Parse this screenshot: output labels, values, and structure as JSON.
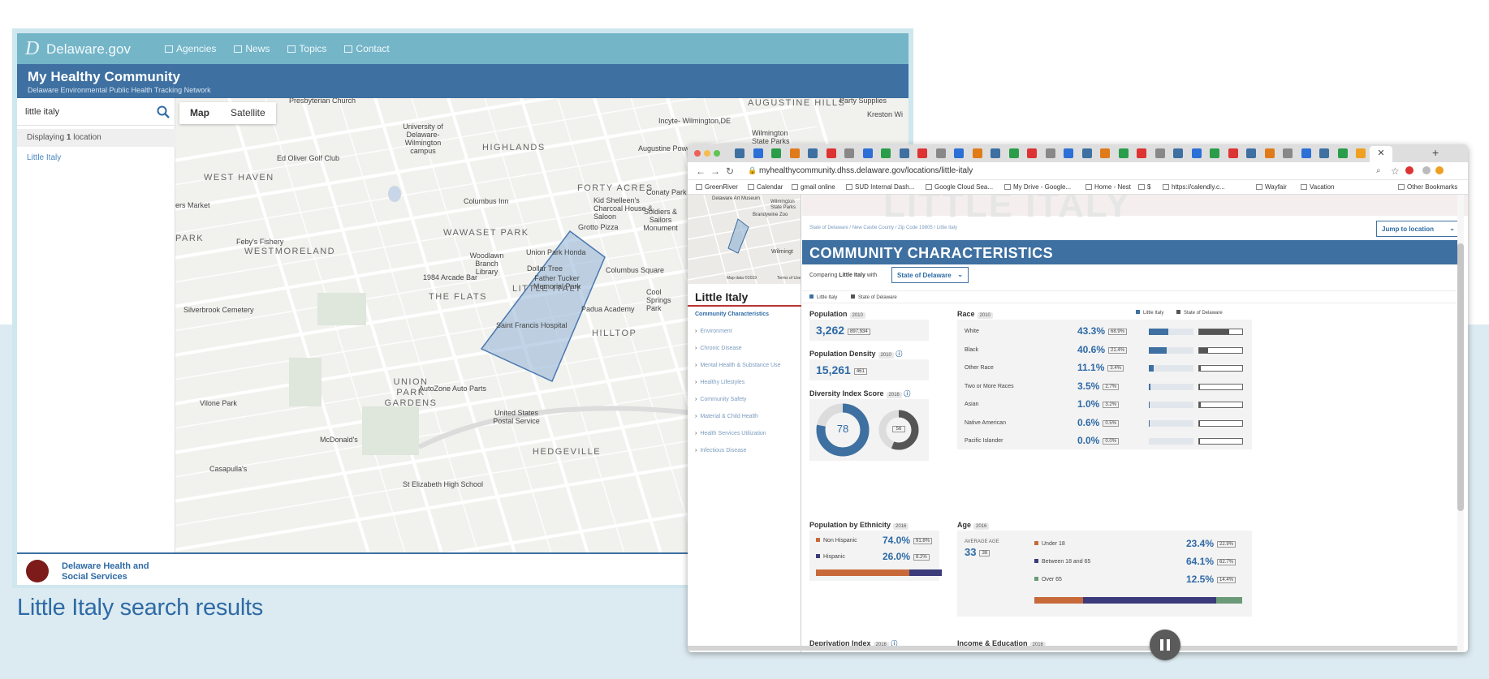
{
  "caption": "Little Italy search results",
  "left_shot": {
    "gov_name": "Delaware.gov",
    "gov_nav": [
      "Agencies",
      "News",
      "Topics",
      "Contact"
    ],
    "app_title": "My Healthy Community",
    "app_subtitle": "Delaware Environmental Public Health Tracking Network",
    "search_value": "little italy",
    "display_prefix": "Displaying ",
    "display_count": "1",
    "display_suffix": " location",
    "result": "Little Italy",
    "map_tabs": [
      "Map",
      "Satellite"
    ],
    "map_areas": [
      "WEST HAVEN",
      "WESTMORELAND",
      "WAWASET PARK",
      "THE FLATS",
      "LITTLE ITALY",
      "HILLTOP",
      "UNION PARK GARDENS",
      "HEDGEVILLE",
      "HIGHLANDS",
      "FORTY ACRES",
      "AUGUSTINE HILLS",
      "PARK"
    ],
    "map_labels": [
      "Presbyterian Church",
      "University of Delaware-Wilmington campus",
      "Ed Oliver Golf Club",
      "Columbus Inn",
      "Grotto Pizza",
      "Union Park Honda",
      "Woodlawn Branch Library",
      "Dollar Tree",
      "Father Tucker Memorial Park",
      "1984 Arcade Bar",
      "Columbus Square",
      "Padua Academy",
      "Saint Francis Hospital",
      "Silverbrook Cemetery",
      "Feby's Fishery",
      "AutoZone Auto Parts",
      "United States Postal Service",
      "Vilone Park",
      "McDonald's",
      "Casapulla's",
      "St Elizabeth High School",
      "Augustine Power Park",
      "Kid Shelleen's Charcoal House & Saloon",
      "Soldiers & Sailors Monument",
      "Conaty Park",
      "Cool Springs Park",
      "Incyte- Wilmington,DE",
      "Wilmington State Parks",
      "Kreston Wi",
      "Party Supplies",
      "ers Market"
    ],
    "footer_line1": "Delaware Health and",
    "footer_line2": "Social Services"
  },
  "right_shot": {
    "url": "myhealthycommunity.dhss.delaware.gov/locations/little-italy",
    "bookmarks": [
      "GreenRiver",
      "Calendar",
      "gmail online",
      "SUD Internal Dash...",
      "Google Cloud Sea...",
      "My Drive - Google...",
      "Home - Nest",
      "$",
      "https://calendly.c...",
      "Wayfair",
      "Vacation",
      "Other Bookmarks"
    ],
    "minimap_labels": [
      "Delaware Art Museum",
      "Wilmington State Parks",
      "Brandywine Zoo",
      "Wilmingt",
      "Map data ©2019",
      "Terms of Use"
    ],
    "sidebar_title": "Little Italy",
    "sidebar_current": "Community Characteristics",
    "sidebar_items": [
      "Environment",
      "Chronic Disease",
      "Mental Health & Substance Use",
      "Healthy Lifestyles",
      "Community Safety",
      "Material & Child Health",
      "Health Services Utilization",
      "Infectious Disease"
    ],
    "ghost_title": "LITTLE ITALY",
    "breadcrumb": "State of Delaware / New Castle County / Zip Code 19805 / Little Italy",
    "jump_label": "Jump to location",
    "section_title": "COMMUNITY CHARACTERISTICS",
    "comparing_prefix": "Comparing ",
    "comparing_place": "Little Italy",
    "comparing_with": " with",
    "compare_select": "State of Delaware",
    "legend_local": "Little Italy",
    "legend_state": "State of Delaware",
    "colors": {
      "local": "#3e70a1",
      "state": "#555555",
      "accent_orange": "#c8693a",
      "navy": "#3b3a7a",
      "green": "#6a9a77"
    },
    "population": {
      "label": "Population",
      "year": "2010",
      "value": "3,262",
      "state": "897,934"
    },
    "density": {
      "label": "Population Density",
      "year": "2010",
      "value": "15,261",
      "state": "461"
    },
    "diversity": {
      "label": "Diversity Index Score",
      "year": "2016",
      "value": "78",
      "state": "56",
      "value_num": 78,
      "state_num": 56
    },
    "race": {
      "label": "Race",
      "year": "2010",
      "rows": [
        {
          "name": "White",
          "value": "43.3%",
          "state": "68.9%",
          "v": 43.3,
          "s": 68.9
        },
        {
          "name": "Black",
          "value": "40.6%",
          "state": "21.4%",
          "v": 40.6,
          "s": 21.4
        },
        {
          "name": "Other Race",
          "value": "11.1%",
          "state": "3.4%",
          "v": 11.1,
          "s": 3.4
        },
        {
          "name": "Two or More Races",
          "value": "3.5%",
          "state": "2.7%",
          "v": 3.5,
          "s": 2.7
        },
        {
          "name": "Asian",
          "value": "1.0%",
          "state": "3.2%",
          "v": 1.0,
          "s": 3.2
        },
        {
          "name": "Native American",
          "value": "0.6%",
          "state": "0.5%",
          "v": 0.6,
          "s": 0.5
        },
        {
          "name": "Pacific Islander",
          "value": "0.0%",
          "state": "0.0%",
          "v": 0.0,
          "s": 0.0
        }
      ]
    },
    "ethnicity": {
      "label": "Population by Ethnicity",
      "year": "2016",
      "rows": [
        {
          "name": "Non Hispanic",
          "value": "74.0%",
          "state": "91.8%"
        },
        {
          "name": "Hispanic",
          "value": "26.0%",
          "state": "8.2%"
        }
      ],
      "split": [
        74.0,
        26.0
      ]
    },
    "age": {
      "label": "Age",
      "year": "2016",
      "avg_label": "AVERAGE AGE",
      "avg_value": "33",
      "avg_state": "38",
      "rows": [
        {
          "name": "Under 18",
          "value": "23.4%",
          "state": "22.9%"
        },
        {
          "name": "Between 18 and 65",
          "value": "64.1%",
          "state": "62.7%"
        },
        {
          "name": "Over 65",
          "value": "12.5%",
          "state": "14.4%"
        }
      ],
      "split": [
        23.4,
        64.1,
        12.5
      ]
    },
    "deprivation": {
      "label": "Deprivation Index",
      "year": "2016"
    },
    "income": {
      "label": "Income & Education",
      "year": "2016"
    }
  }
}
